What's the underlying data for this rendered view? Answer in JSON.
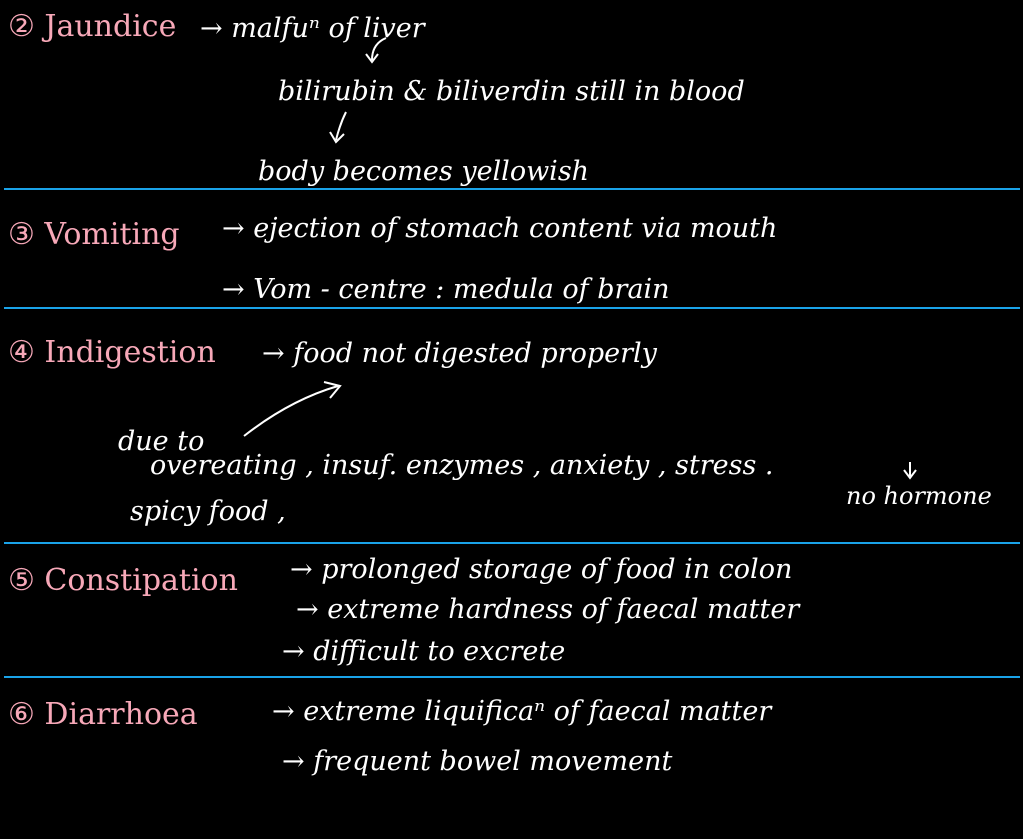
{
  "colors": {
    "background": "#000000",
    "ink": "#ffffff",
    "heading": "#f7a8b8",
    "divider": "#1aa3e8"
  },
  "sections": [
    {
      "heading": "② Jaundice",
      "lines": [
        "→ malfuⁿ of liver",
        "bilirubin & biliverdin still in blood",
        "body becomes yellowish"
      ]
    },
    {
      "heading": "③ Vomiting",
      "lines": [
        "→ ejection of stomach content via mouth",
        "→ Vom - centre : medula of brain"
      ]
    },
    {
      "heading": "④ Indigestion",
      "lines": [
        "→ food not digested properly",
        "due to",
        "overeating , insuf. enzymes , anxiety , stress .",
        "spicy food ,",
        "no hormone"
      ]
    },
    {
      "heading": "⑤ Constipation",
      "lines": [
        "→ prolonged storage of food in colon",
        "→ extreme hardness of faecal matter",
        "→ difficult to excrete"
      ]
    },
    {
      "heading": "⑥ Diarrhoea",
      "lines": [
        "→ extreme liquificaⁿ of faecal matter",
        "→ frequent bowel movement"
      ]
    }
  ]
}
